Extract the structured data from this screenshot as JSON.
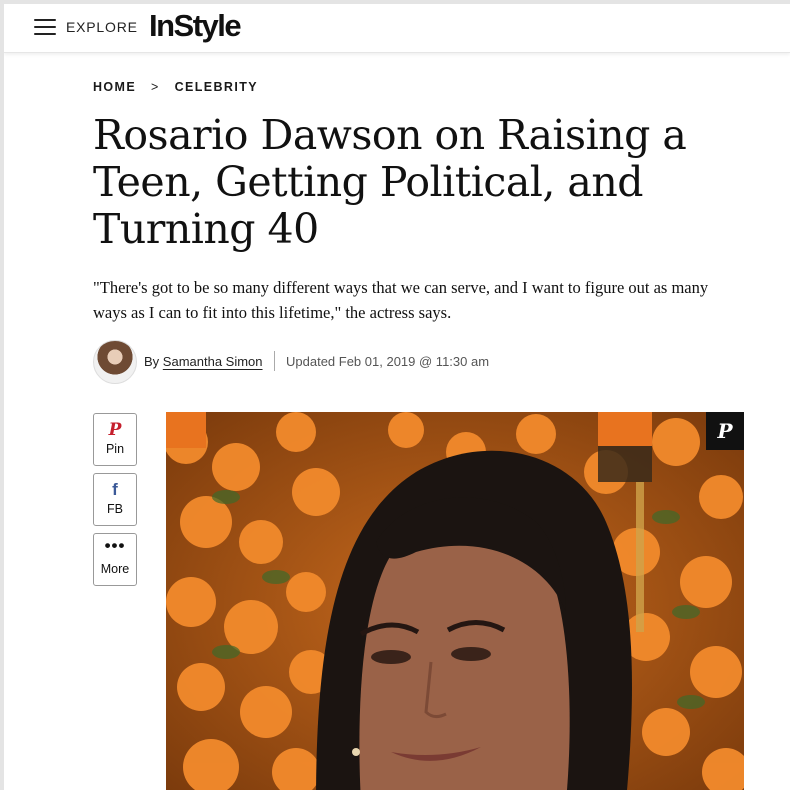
{
  "header": {
    "menu_icon": "hamburger-menu-icon",
    "explore_label": "EXPLORE",
    "logo_text": "InStyle"
  },
  "breadcrumb": {
    "items": [
      "HOME",
      "CELEBRITY"
    ],
    "separator": ">"
  },
  "article": {
    "title": "Rosario Dawson on Raising a Teen, Getting Political, and Turning 40",
    "dek": "\"There's got to be so many different ways that we can serve, and I want to figure out as many ways as I can to fit into this lifetime,\" the actress says.",
    "byline": {
      "by_label": "By",
      "author": "Samantha Simon",
      "updated": "Updated Feb 01, 2019 @ 11:30 am"
    }
  },
  "share": {
    "pin": {
      "icon": "pinterest-icon",
      "glyph": "P",
      "label": "Pin"
    },
    "fb": {
      "icon": "facebook-icon",
      "glyph": "f",
      "label": "FB"
    },
    "more": {
      "icon": "more-dots-icon",
      "glyph": "•••",
      "label": "More"
    }
  },
  "hero": {
    "pin_glyph": "P",
    "pin_icon": "pinterest-icon"
  },
  "colors": {
    "accent_pin": "#c51f2d",
    "facebook": "#3b5998",
    "flowers": "#f0872a"
  }
}
